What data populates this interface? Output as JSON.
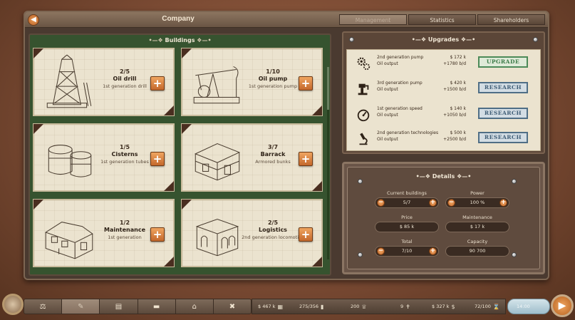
{
  "window": {
    "title": "Company",
    "tabs": [
      {
        "label": "Management",
        "active": true
      },
      {
        "label": "Statistics",
        "active": false
      },
      {
        "label": "Shareholders",
        "active": false
      }
    ]
  },
  "buildings": {
    "title": "Buildings",
    "cards": [
      {
        "count": "2/5",
        "name": "Oil drill",
        "sub": "1st generation drill",
        "icon": "oil-drill-tower"
      },
      {
        "count": "1/10",
        "name": "Oil pump",
        "sub": "1st generation pump",
        "icon": "oil-pump-jack"
      },
      {
        "count": "1/5",
        "name": "Cisterns",
        "sub": "1st generation tubes",
        "icon": "cisterns"
      },
      {
        "count": "3/7",
        "name": "Barrack",
        "sub": "Armored bunks",
        "icon": "barrack"
      },
      {
        "count": "1/2",
        "name": "Maintenance",
        "sub": "1st generation",
        "icon": "maintenance-house"
      },
      {
        "count": "2/5",
        "name": "Logistics",
        "sub": "2nd generation locomotive",
        "icon": "logistics-depot"
      }
    ]
  },
  "upgrades": {
    "title": "Upgrades",
    "items": [
      {
        "name": "2nd generation pump",
        "cost": "$ 172 k",
        "metric": "Oil output",
        "value": "+1780 b/d",
        "action": "UPGRADE",
        "icon": "gears-icon"
      },
      {
        "name": "3rd generation pump",
        "cost": "$ 420 k",
        "metric": "Oil output",
        "value": "+1500 b/d",
        "action": "RESEARCH",
        "icon": "pump-icon"
      },
      {
        "name": "1st generation speed",
        "cost": "$ 140 k",
        "metric": "Oil output",
        "value": "+1050 b/d",
        "action": "RESEARCH",
        "icon": "speedometer-icon"
      },
      {
        "name": "2nd generation technologies",
        "cost": "$ 500 k",
        "metric": "Oil output",
        "value": "+2500 b/d",
        "action": "RESEARCH",
        "icon": "microscope-icon"
      }
    ]
  },
  "details": {
    "title": "Details",
    "current_buildings_label": "Current buildings",
    "current_buildings_value": "5/7",
    "power_label": "Power",
    "power_value": "100 %",
    "price_label": "Price",
    "price_value": "$ 85 k",
    "maintenance_label": "Maintenance",
    "maintenance_value": "$ 17 k",
    "total_label": "Total",
    "total_value": "7/10",
    "capacity_label": "Capacity",
    "capacity_value": "90 700"
  },
  "bottom": {
    "stats": [
      {
        "value": "$ 467 k",
        "icon": "calculator-icon"
      },
      {
        "value": "275/356",
        "icon": "barrel-icon"
      },
      {
        "value": "200",
        "icon": "crown-icon"
      },
      {
        "value": "9",
        "icon": "worker-icon"
      },
      {
        "value": "$ 327 k",
        "icon": "dollar-icon"
      },
      {
        "value": "72/100",
        "icon": "hourglass-icon"
      }
    ],
    "time": "14:00"
  },
  "colors": {
    "panel_green": "#36532f",
    "upgrade_green": "#4c8a58",
    "research_blue": "#4f6e86",
    "orange_button": "#e08a45"
  }
}
